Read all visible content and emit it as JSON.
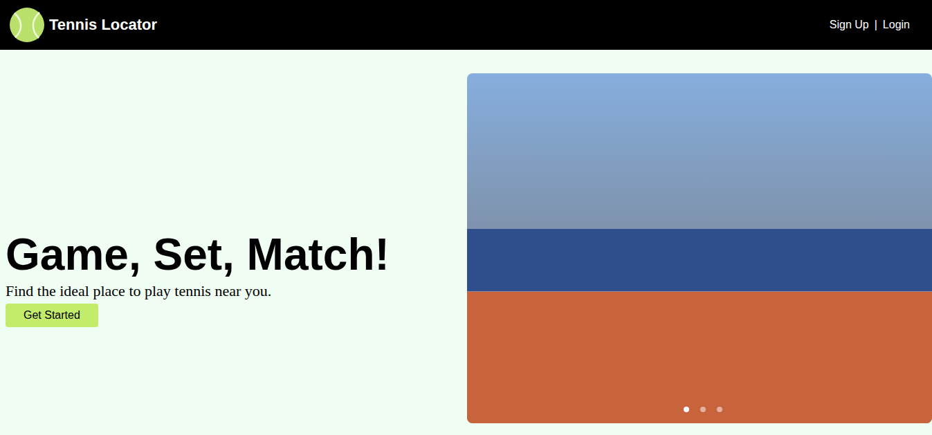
{
  "header": {
    "logo": "Tennis Locator",
    "nav": [
      "Sign Up",
      "Login"
    ],
    "separator": "|"
  },
  "hero": {
    "title": "Game, Set, Match!",
    "subtitle": "Find the ideal place to play tennis near you.",
    "button": "Get Started"
  },
  "carousel": {
    "slides": [
      {
        "selected": true
      },
      {
        "selected": false
      },
      {
        "selected": false
      }
    ]
  }
}
